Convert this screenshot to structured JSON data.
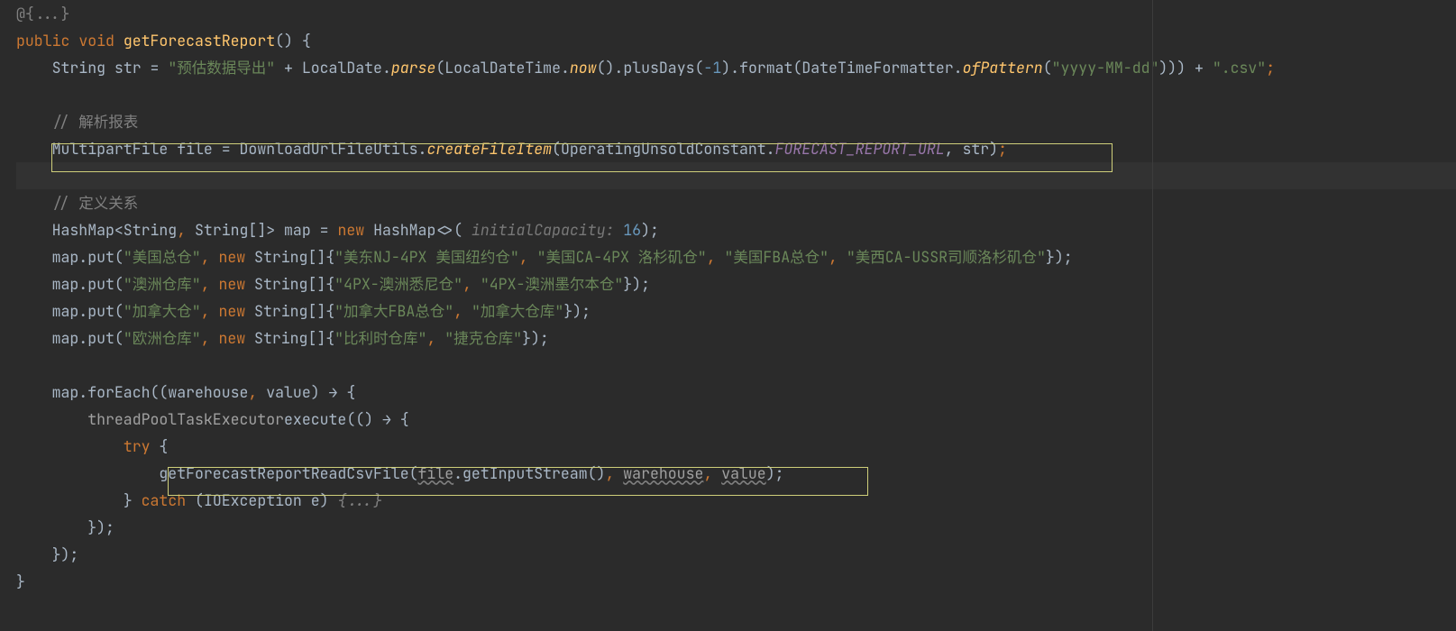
{
  "annotation_fold": "@{...}",
  "sig": {
    "modifier": "public",
    "retType": "void",
    "method": "getForecastReport",
    "params": "() {"
  },
  "assign1": {
    "indent": "    ",
    "type": "String ",
    "name": "str ",
    "eq": "= ",
    "str1": "\"预估数据导出\"",
    "plus1": " + ",
    "cls1": "LocalDate",
    "dot1": ".",
    "m1": "parse",
    "open1": "(",
    "cls2": "LocalDateTime",
    "dot2": ".",
    "m2": "now",
    "par2": "()",
    "dot3": ".",
    "call3": "plusDays(",
    "neg": "-1",
    "close3": ")",
    "dot4": ".",
    "call4": "format(",
    "cls3": "DateTimeFormatter",
    "dot5": ".",
    "m3": "ofPattern",
    "open5": "(",
    "str2": "\"yyyy-MM-dd\"",
    "close5": ")))",
    "plus2": " + ",
    "str3": "\".csv\"",
    "semi": ";"
  },
  "blank1": " ",
  "comment1": "    // 解析报表",
  "line6": {
    "indent": "    ",
    "t1": "MultipartFile ",
    "v": "file ",
    "eq": "= ",
    "cls": "DownloadUrlFileUtils",
    "dot": ".",
    "m": "createFileItem",
    "open": "(",
    "c2": "OperatingUnsoldConstant",
    "dot2": ".",
    "cst": "FORECAST_REPORT_URL",
    "mid": ", str)",
    "semi": ";"
  },
  "blank2": " ",
  "comment2": "    // 定义关系",
  "line9": {
    "indent": "    ",
    "t1": "HashMap<String",
    "c1": ", ",
    "t2": "String[]> ",
    "v": "map ",
    "eq": "= ",
    "kw": "new ",
    "t3": "HashMap<>( ",
    "hint": "initialCapacity: ",
    "num": "16",
    "tail": ");"
  },
  "put1": {
    "indent": "    ",
    "pre": "map.put(",
    "k": "\"美国总仓\"",
    "mid": ", ",
    "kw": "new ",
    "t": "String[]{",
    "v1": "\"美东NJ-4PX 美国纽约仓\"",
    "c1": ", ",
    "v2": "\"美国CA-4PX 洛杉矶仓\"",
    "c2": ", ",
    "v3": "\"美国FBA总仓\"",
    "c3": ", ",
    "v4": "\"美西CA-USSR司顺洛杉矶仓\"",
    "end": "});"
  },
  "put2": {
    "indent": "    ",
    "pre": "map.put(",
    "k": "\"澳洲仓库\"",
    "mid": ", ",
    "kw": "new ",
    "t": "String[]{",
    "v1": "\"4PX-澳洲悉尼仓\"",
    "c1": ", ",
    "v2": "\"4PX-澳洲墨尔本仓\"",
    "end": "});"
  },
  "put3": {
    "indent": "    ",
    "pre": "map.put(",
    "k": "\"加拿大仓\"",
    "mid": ", ",
    "kw": "new ",
    "t": "String[]{",
    "v1": "\"加拿大FBA总仓\"",
    "c1": ", ",
    "v2": "\"加拿大仓库\"",
    "end": "});"
  },
  "put4": {
    "indent": "    ",
    "pre": "map.put(",
    "k": "\"欧洲仓库\"",
    "mid": ", ",
    "kw": "new ",
    "t": "String[]{",
    "v1": "\"比利时仓库\"",
    "c1": ", ",
    "v2": "\"捷克仓库\"",
    "end": "});"
  },
  "blank3": " ",
  "forEach": {
    "indent": "    ",
    "pre": "map.forEach((",
    "p1": "warehouse",
    "c": ", ",
    "p2": "value",
    "tail": ") ",
    "arrow": "→",
    " brace": " {"
  },
  "exec": {
    "indent": "        ",
    "obj": "threadPoolTaskExecutor",
    ".": ".",
    "m": "execute",
    "open": "(() ",
    "arrow": "→",
    " brace": " {"
  },
  "try": {
    "indent": "            ",
    "kw": "try ",
    "brace": "{"
  },
  "call": {
    "indent": "                ",
    "m": "getForecastReportReadCsvFile",
    "open": "(",
    "p1": "file",
    "dot": ".",
    "m2": "getInputStream",
    "par": "()",
    "c1": ", ",
    "p2": "warehouse",
    "c2": ", ",
    "p3": "value",
    "close": ");"
  },
  "catch": {
    "indent": "            ",
    "close1": "} ",
    "kw": "catch ",
    "open": "(",
    "t": "IOException ",
    "v": "e",
    "close2": ") ",
    "fold": "{...}"
  },
  "close_exec": "        });",
  "close_fe": "    });",
  "close_m": "}",
  "rule_x": "1278"
}
